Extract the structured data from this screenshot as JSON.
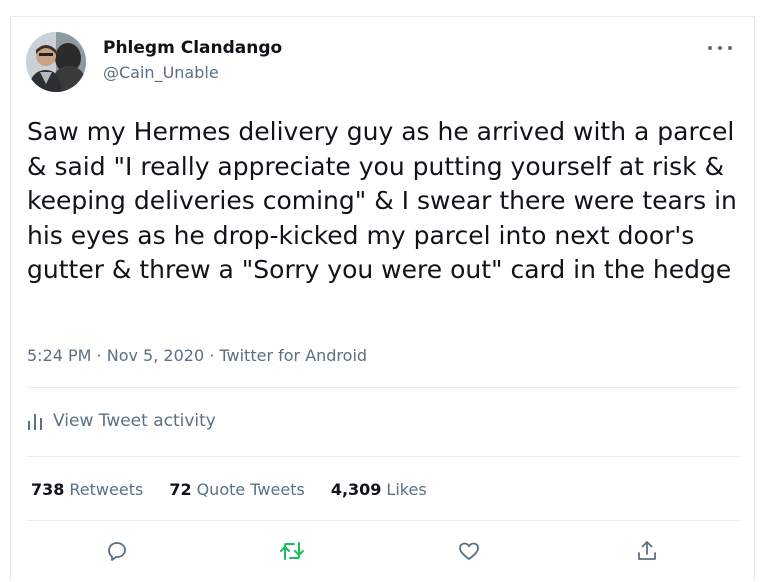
{
  "tweet": {
    "author_name": "Phlegm Clandango",
    "author_handle": "@Cain_Unable",
    "text": "Saw my Hermes delivery guy as he arrived with a parcel & said \"I really appreciate you putting yourself at risk & keeping deliveries coming\" & I swear there were tears in his eyes as he drop-kicked my parcel into next door's gutter & threw a \"Sorry you were out\" card in the hedge",
    "time": "5:24 PM",
    "date": "Nov 5, 2020",
    "source": "Twitter for Android",
    "separator": " · "
  },
  "activity": {
    "label": "View Tweet activity",
    "icon": "bar-chart-icon"
  },
  "stats": {
    "retweets_count": "738",
    "retweets_label": "Retweets",
    "quotes_count": "72",
    "quotes_label": "Quote Tweets",
    "likes_count": "4,309",
    "likes_label": "Likes"
  },
  "actions": {
    "reply_icon": "reply-icon",
    "retweet_icon": "retweet-icon",
    "like_icon": "heart-icon",
    "share_icon": "share-icon"
  },
  "colors": {
    "text": "#0f1419",
    "secondary": "#5b7083",
    "retweet_active": "#17bf63",
    "border": "#e6ecf0"
  }
}
